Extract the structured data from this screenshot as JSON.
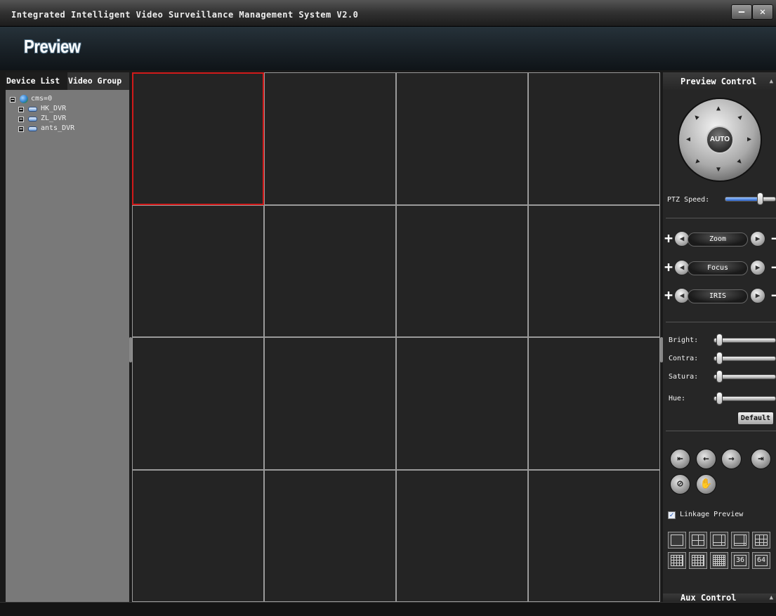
{
  "window": {
    "title": "Integrated Intelligent Video Surveillance Management System V2.0",
    "minimize_symbol": "–",
    "close_symbol": "✕"
  },
  "banner": {
    "heading": "Preview"
  },
  "left_panel": {
    "tabs": [
      {
        "label": "Device List",
        "active": true
      },
      {
        "label": "Video Group",
        "active": false
      }
    ],
    "tree": {
      "root": {
        "label": "cms=0",
        "icon": "globe-icon"
      },
      "devices": [
        {
          "label": "HK_DVR",
          "icon": "dvr-icon"
        },
        {
          "label": "ZL_DVR",
          "icon": "dvr-icon"
        },
        {
          "label": "ants_DVR",
          "icon": "dvr-icon"
        }
      ]
    }
  },
  "video_grid": {
    "rows": 4,
    "cols": 4,
    "selected_cell": 0,
    "selected_color": "#d11a1a"
  },
  "right_panel": {
    "preview_control": {
      "header": "Preview Control",
      "ptz": {
        "center_label": "AUTO"
      },
      "ptz_speed": {
        "label": "PTZ Speed:",
        "value": 0.72
      },
      "lens": [
        {
          "label": "Zoom",
          "plus": "+",
          "minus": "−"
        },
        {
          "label": "Focus",
          "plus": "+",
          "minus": "−"
        },
        {
          "label": "IRIS",
          "plus": "+",
          "minus": "−"
        }
      ],
      "image": [
        {
          "label": "Bright:",
          "value": 0.05
        },
        {
          "label": "Contra:",
          "value": 0.05
        },
        {
          "label": "Satura:",
          "value": 0.05
        },
        {
          "label": "Hue:",
          "value": 0.05
        }
      ],
      "default_button": "Default",
      "linkage": {
        "label": "Linkage Preview",
        "checked": true
      },
      "layouts": {
        "row1": [
          "layout-1",
          "layout-4",
          "layout-6",
          "layout-8",
          "layout-9"
        ],
        "row2": [
          "layout-16",
          "layout-13",
          "layout-25",
          "36",
          "64"
        ]
      }
    },
    "aux_control": {
      "header": "Aux Control"
    }
  },
  "colors": {
    "accent": "#d11a1a",
    "slider_fill": "#2a62c8"
  }
}
